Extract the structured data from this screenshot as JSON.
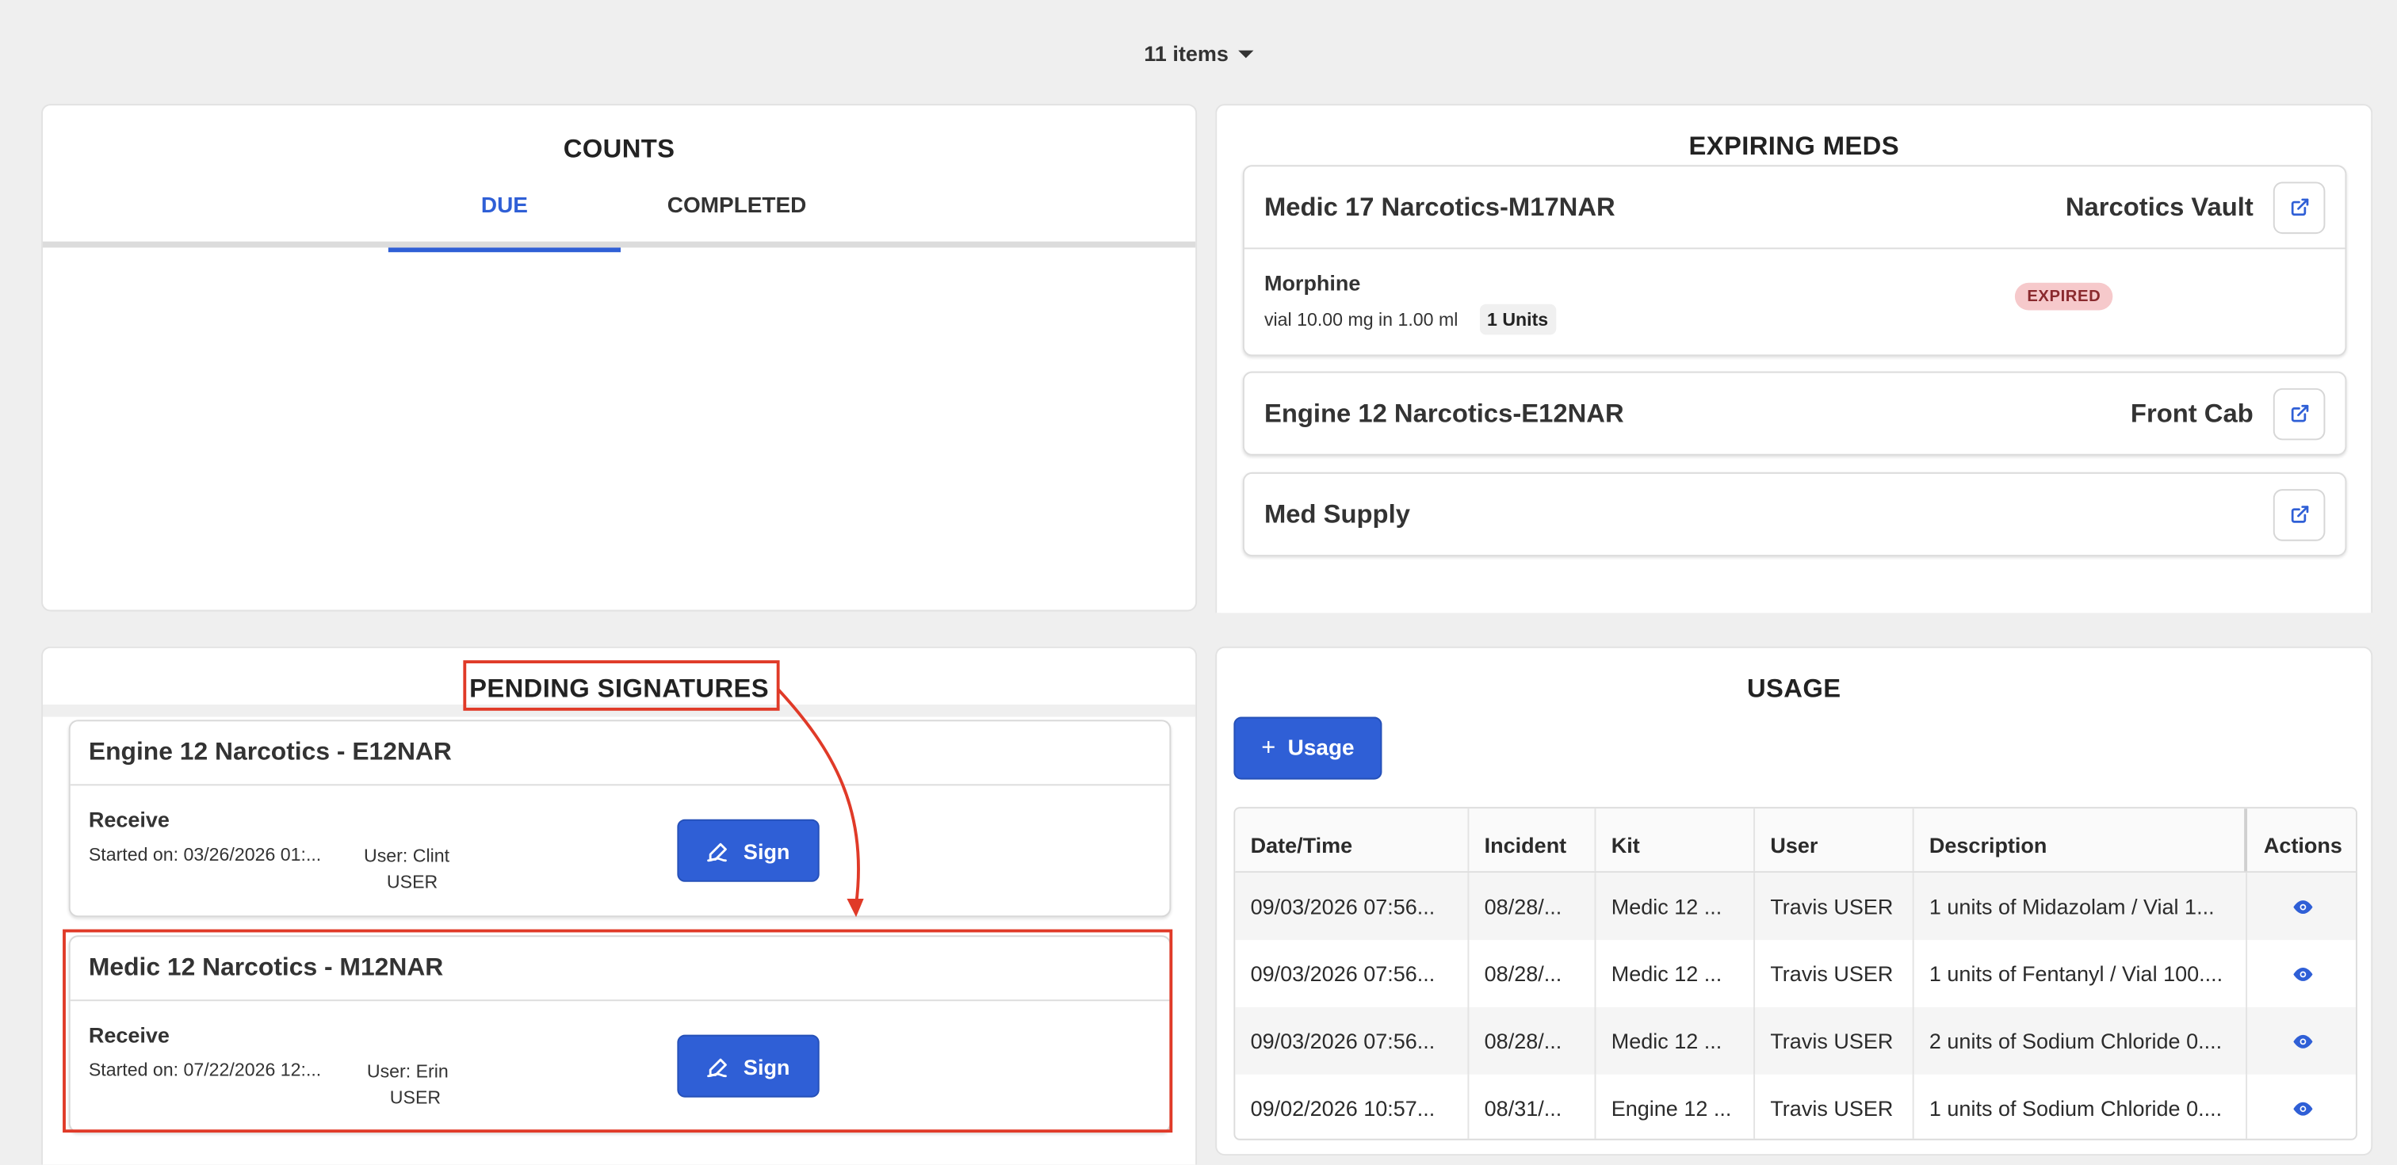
{
  "header": {
    "items_count": "11 items"
  },
  "counts": {
    "title": "COUNTS",
    "tabs": [
      {
        "label": "DUE",
        "active": true
      },
      {
        "label": "COMPLETED",
        "active": false
      }
    ]
  },
  "expiring": {
    "title": "EXPIRING MEDS",
    "kits": [
      {
        "name": "Medic 17 Narcotics-M17NAR",
        "location": "Narcotics Vault",
        "med": {
          "name": "Morphine",
          "desc": "vial 10.00 mg in 1.00 ml",
          "units": "1 Units",
          "status": "EXPIRED"
        }
      },
      {
        "name": "Engine 12 Narcotics-E12NAR",
        "location": "Front Cab"
      },
      {
        "name": "Med Supply",
        "location": ""
      }
    ]
  },
  "pending": {
    "title": "PENDING SIGNATURES",
    "items": [
      {
        "kit": "Engine 12 Narcotics - E12NAR",
        "action": "Receive",
        "started": "Started on: 03/26/2026 01:...",
        "user_line1": "User: Clint",
        "user_line2": "USER",
        "button": "Sign"
      },
      {
        "kit": "Medic 12 Narcotics - M12NAR",
        "action": "Receive",
        "started": "Started on: 07/22/2026 12:...",
        "user_line1": "User: Erin",
        "user_line2": "USER",
        "button": "Sign"
      }
    ]
  },
  "usage": {
    "title": "USAGE",
    "add_button": "Usage",
    "columns": [
      "Date/Time",
      "Incident",
      "Kit",
      "User",
      "Description",
      "Actions"
    ],
    "rows": [
      [
        "09/03/2026 07:56...",
        "08/28/...",
        "Medic 12 ...",
        "Travis USER",
        "1 units of Midazolam / Vial 1..."
      ],
      [
        "09/03/2026 07:56...",
        "08/28/...",
        "Medic 12 ...",
        "Travis USER",
        "1 units of Fentanyl / Vial 100...."
      ],
      [
        "09/03/2026 07:56...",
        "08/28/...",
        "Medic 12 ...",
        "Travis USER",
        "2 units of Sodium Chloride 0...."
      ],
      [
        "09/02/2026 10:57...",
        "08/31/...",
        "Engine 12 ...",
        "Travis USER",
        "1 units of Sodium Chloride 0...."
      ]
    ]
  },
  "colors": {
    "accent": "#2f5fd6",
    "highlight": "#e03a28",
    "expired_bg": "#f6c9cb",
    "expired_text": "#8a2a2e"
  },
  "icons": {
    "external_link": "external-link-icon",
    "sign": "signature-pen-icon",
    "view": "eye-icon",
    "dropdown": "caret-down-icon"
  }
}
